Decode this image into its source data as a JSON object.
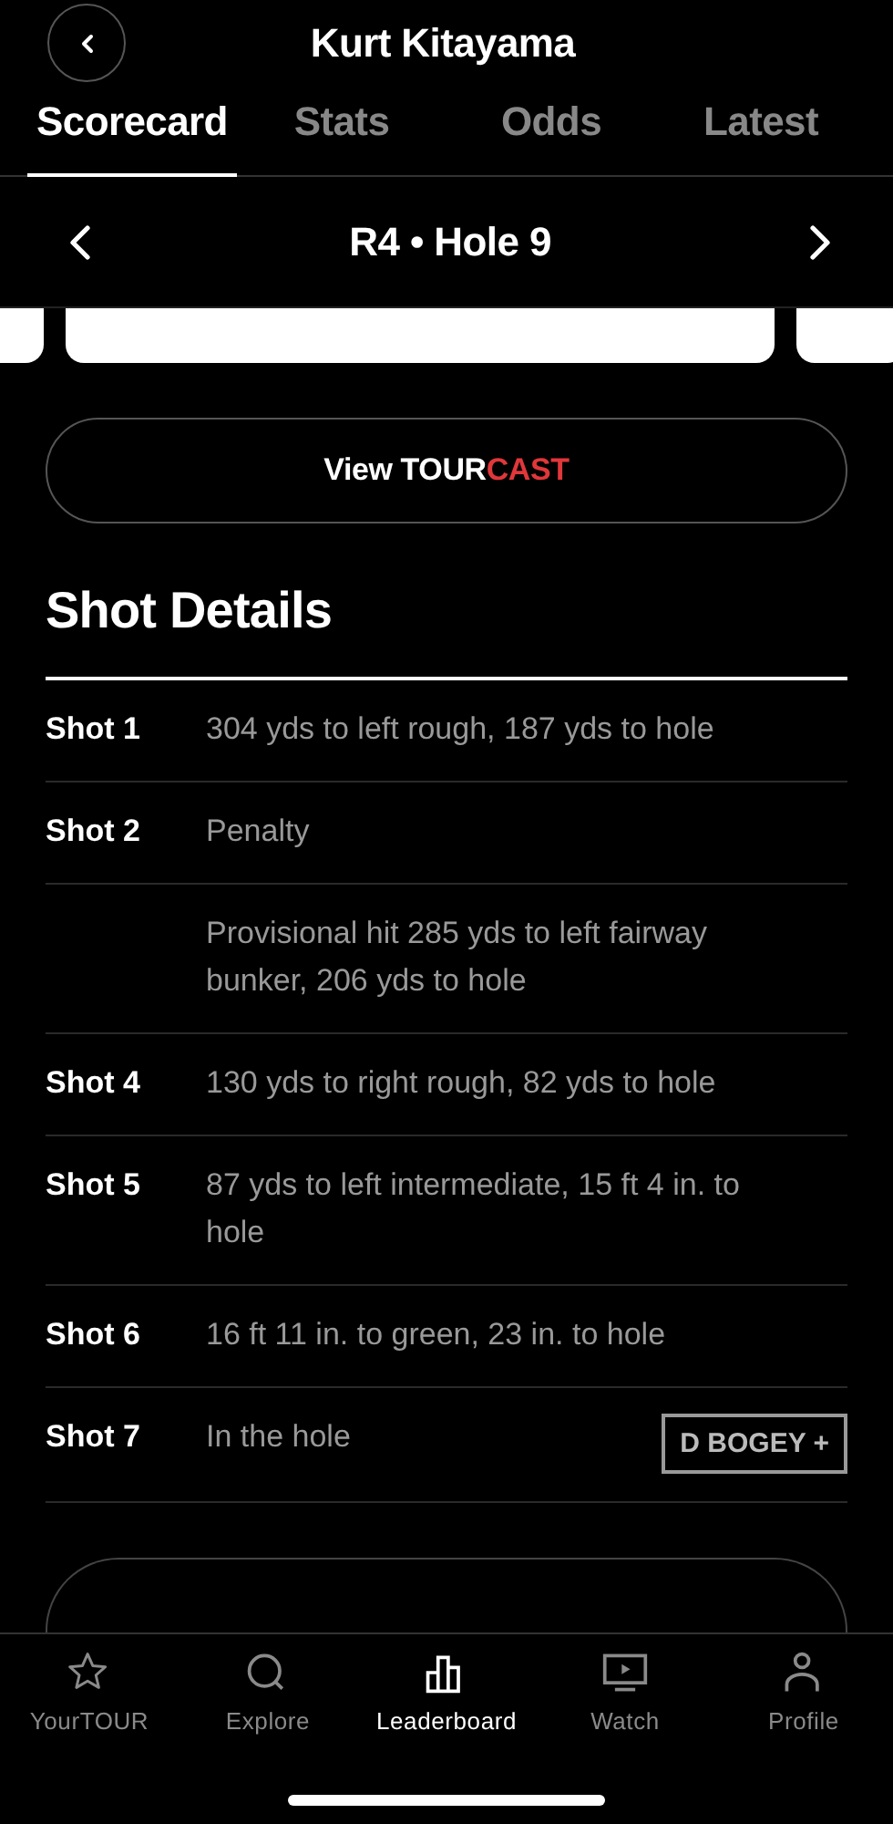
{
  "header": {
    "title": "Kurt Kitayama"
  },
  "tabs": [
    {
      "label": "Scorecard",
      "selected": true
    },
    {
      "label": "Stats",
      "selected": false
    },
    {
      "label": "Odds",
      "selected": false
    },
    {
      "label": "Latest",
      "selected": false
    }
  ],
  "round_bar": {
    "title": "R4 • Hole 9"
  },
  "tourcast_button": {
    "parts": [
      {
        "text": "View TOUR",
        "color": "#ffffff"
      },
      {
        "text": "CAST",
        "color": "#e0373b"
      }
    ]
  },
  "shot_details": {
    "heading": "Shot Details",
    "rows": [
      {
        "label": "Shot 1",
        "description": "304 yds to left rough, 187 yds to hole"
      },
      {
        "label": "Shot 2",
        "description": "Penalty"
      },
      {
        "description": "Provisional hit 285 yds to left fairway bunker, 206 yds to hole"
      },
      {
        "label": "Shot 4",
        "description": "130 yds to right rough, 82 yds to hole"
      },
      {
        "label": "Shot 5",
        "description": "87 yds to left intermediate, 15 ft 4 in. to hole"
      },
      {
        "label": "Shot 6",
        "description": "16 ft 11 in. to green, 23 in. to hole"
      },
      {
        "label": "Shot 7",
        "description": "In the hole",
        "score": "D BOGEY +"
      }
    ]
  },
  "bottom_nav": [
    {
      "kind": "star",
      "label": "YourTOUR",
      "selected": false
    },
    {
      "kind": "search",
      "label": "Explore",
      "selected": false
    },
    {
      "kind": "chart",
      "label": "Leaderboard",
      "selected": true
    },
    {
      "kind": "tv",
      "label": "Watch",
      "selected": false
    },
    {
      "kind": "person",
      "label": "Profile",
      "selected": false
    }
  ]
}
